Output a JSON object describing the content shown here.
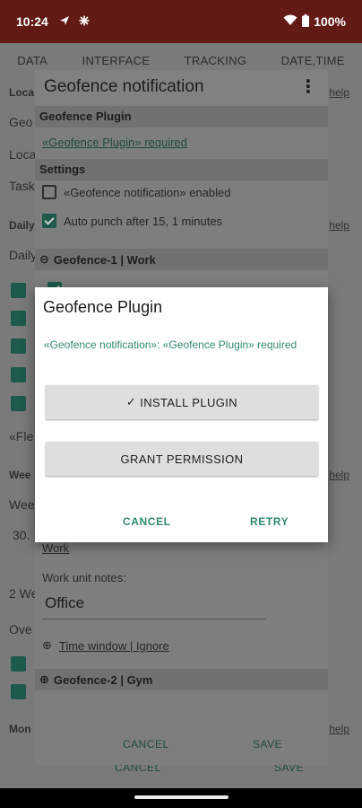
{
  "status": {
    "time": "10:24",
    "icons": [
      "navigation-icon",
      "fan-icon"
    ],
    "battery": "100%"
  },
  "background": {
    "tabs": [
      "DATA",
      "INTERFACE",
      "TRACKING",
      "DATE,TIME"
    ],
    "side_texts": [
      "Loca",
      "Geo",
      "Loca",
      "Task",
      "Daily",
      "Daily",
      "«Fle",
      "Wee",
      "Wee",
      "30.",
      "2 We",
      "Ove",
      "Mon"
    ],
    "help_label": "help",
    "footer": {
      "cancel": "CANCEL",
      "save": "SAVE"
    }
  },
  "sheet": {
    "title": "Geofence notification",
    "sections": {
      "plugin": "Geofence Plugin",
      "settings": "Settings",
      "geofence1": "Geofence-1 | Work",
      "geofence2": "Geofence-2 | Gym"
    },
    "plugin_required": "«Geofence Plugin» required",
    "enabled_label": "«Geofence notification» enabled",
    "auto_punch_label": "Auto punch after 15, 1 minutes",
    "work_label": "Work",
    "notes_label": "Work unit notes:",
    "notes_value": "Office",
    "time_window": "Time window | Ignore",
    "cancel": "CANCEL",
    "save": "SAVE"
  },
  "dialog": {
    "title": "Geofence Plugin",
    "message": "«Geofence notification»: «Geofence Plugin» required",
    "install_button": "INSTALL PLUGIN",
    "install_check": "✓",
    "grant_button": "GRANT PERMISSION",
    "cancel": "CANCEL",
    "retry": "RETRY"
  },
  "colors": {
    "status_bar": "#611a14",
    "accent": "#2f8a6f",
    "dialog_bg": "#ffffff"
  }
}
